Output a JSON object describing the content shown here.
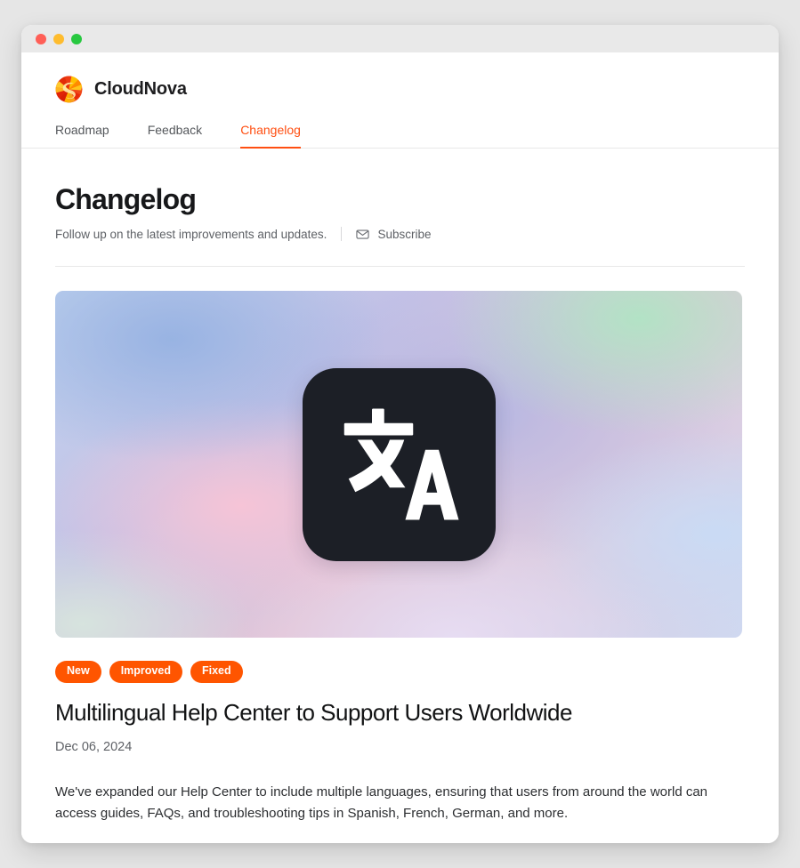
{
  "window": {
    "traffic_lights": [
      {
        "name": "close",
        "color": "#ff5f57"
      },
      {
        "name": "minimize",
        "color": "#febc2e"
      },
      {
        "name": "maximize",
        "color": "#28c840"
      }
    ]
  },
  "brand": {
    "name": "CloudNova",
    "logo_icon": "spiral-swirl-logo-icon"
  },
  "nav": {
    "tabs": [
      {
        "label": "Roadmap",
        "active": false
      },
      {
        "label": "Feedback",
        "active": false
      },
      {
        "label": "Changelog",
        "active": true
      }
    ],
    "active_color": "#ff4f12"
  },
  "header": {
    "title": "Changelog",
    "subtitle": "Follow up on the latest improvements and updates.",
    "subscribe_label": "Subscribe",
    "subscribe_icon": "mail-envelope-icon"
  },
  "entry": {
    "hero_icon": "translate-icon",
    "hero_glyphs": "文A",
    "badges": [
      {
        "label": "New",
        "color": "#ff5500"
      },
      {
        "label": "Improved",
        "color": "#ff5500"
      },
      {
        "label": "Fixed",
        "color": "#ff5500"
      }
    ],
    "title": "Multilingual Help Center to Support Users Worldwide",
    "date": "Dec 06, 2024",
    "body": "We've expanded our Help Center to include multiple languages, ensuring that users from around the world can access guides, FAQs, and troubleshooting tips in Spanish, French, German, and more."
  }
}
